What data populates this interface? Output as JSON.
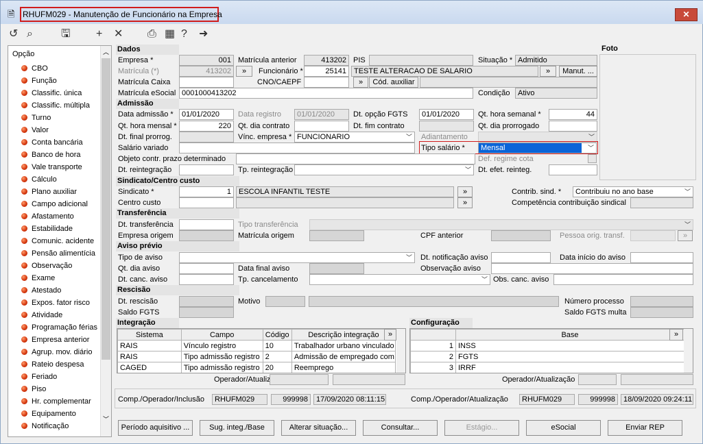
{
  "window": {
    "title": "RHUFM029 - Manutenção de Funcionário na Empresa"
  },
  "left_panel": {
    "header": "Opção",
    "items": [
      "CBO",
      "Função",
      "Classific. única",
      "Classific. múltipla",
      "Turno",
      "Valor",
      "Conta bancária",
      "Banco de hora",
      "Vale transporte",
      "Cálculo",
      "Plano auxiliar",
      "Campo adicional",
      "Afastamento",
      "Estabilidade",
      "Comunic. acidente",
      "Pensão alimentícia",
      "Observação",
      "Exame",
      "Atestado",
      "Expos. fator risco",
      "Atividade",
      "Programação férias",
      "Empresa anterior",
      "Agrup. mov. diário",
      "Rateio despesa",
      "Feriado",
      "Piso",
      "Hr. complementar",
      "Equipamento",
      "Notificação"
    ]
  },
  "foto": {
    "label": "Foto"
  },
  "dados": {
    "title": "Dados",
    "empresa_label": "Empresa *",
    "empresa": "001",
    "matricula_ant_label": "Matrícula anterior",
    "matricula_ant": "413202",
    "pis_label": "PIS",
    "situacao_label": "Situação *",
    "situacao": "Admitido",
    "matricula_label": "Matrícula (*)",
    "matricula": "413202",
    "funcionario_label": "Funcionário *",
    "funcionario": "25141",
    "funcionario_nome": "TESTE ALTERACAO DE SALARIO",
    "manut_btn": "Manut. ...",
    "matricula_caixa_label": "Matrícula Caixa",
    "cno_label": "CNO/CAEPF",
    "cod_aux_btn": "Cód. auxiliar",
    "matricula_esocial_label": "Matrícula eSocial",
    "matricula_esocial": "0001000413202",
    "condicao_label": "Condição",
    "condicao": "Ativo"
  },
  "admissao": {
    "title": "Admissão",
    "data_adm_label": "Data admissão *",
    "data_adm": "01/01/2020",
    "data_reg_label": "Data registro",
    "data_reg": "01/01/2020",
    "dt_opcao_label": "Dt. opção FGTS",
    "dt_opcao": "01/01/2020",
    "qt_hora_sem_label": "Qt. hora semanal *",
    "qt_hora_sem": "44",
    "qt_hora_mensal_label": "Qt. hora mensal *",
    "qt_hora_mensal": "220",
    "qt_dia_contrato_label": "Qt. dia contrato",
    "dt_fim_contrato_label": "Dt. fim contrato",
    "qt_dia_prorrogado_label": "Qt. dia prorrogado",
    "dt_final_prorrog_label": "Dt. final prorrog.",
    "vinc_empresa_label": "Vínc. empresa *",
    "vinc_empresa": "FUNCIONARIO",
    "adiantamento_label": "Adiantamento",
    "salario_variado_label": "Salário variado",
    "tipo_salario_label": "Tipo salário *",
    "tipo_salario": "Mensal",
    "objeto_label": "Objeto contr. prazo determinado",
    "def_regime_label": "Def. regime cota",
    "dt_reintegracao_label": "Dt. reintegração",
    "tp_reintegracao_label": "Tp. reintegração",
    "dt_efet_reinteg_label": "Dt. efet. reinteg."
  },
  "sindicato": {
    "title": "Sindicato/Centro custo",
    "sindicato_label": "Sindicato *",
    "sindicato": "1",
    "sindicato_nome": "ESCOLA INFANTIL TESTE",
    "centro_custo_label": "Centro custo",
    "contrib_label": "Contrib. sind. *",
    "contrib": "Contribuiu no ano base",
    "competencia_label": "Competência contribuição sindical"
  },
  "transferencia": {
    "title": "Transferência",
    "dt_transf_label": "Dt. transferência",
    "tipo_transf_label": "Tipo transferência",
    "empresa_origem_label": "Empresa origem",
    "matricula_origem_label": "Matrícula origem",
    "cpf_anterior_label": "CPF anterior",
    "pessoa_orig_label": "Pessoa orig. transf."
  },
  "aviso": {
    "title": "Aviso prévio",
    "tipo_label": "Tipo de aviso",
    "dt_notif_label": "Dt. notificação aviso",
    "data_inicio_label": "Data início do aviso",
    "qt_dia_label": "Qt. dia aviso",
    "data_final_label": "Data final aviso",
    "obs_label": "Observação aviso",
    "dt_canc_label": "Dt. canc. aviso",
    "tp_canc_label": "Tp. cancelamento",
    "obs_canc_label": "Obs. canc. aviso"
  },
  "rescisao": {
    "title": "Rescisão",
    "dt_label": "Dt. rescisão",
    "motivo_label": "Motivo",
    "num_proc_label": "Número processo",
    "saldo_fgts_label": "Saldo FGTS",
    "saldo_multa_label": "Saldo FGTS multa"
  },
  "integracao": {
    "title": "Integração",
    "headers": [
      "Sistema",
      "Campo",
      "Código",
      "Descrição integração"
    ],
    "rows": [
      [
        "RAIS",
        "Vínculo registro",
        "10",
        "Trabalhador urbano vinculado a"
      ],
      [
        "RAIS",
        "Tipo admissão registro",
        "2",
        "Admissão de empregado com e"
      ],
      [
        "CAGED",
        "Tipo admissão registro",
        "20",
        "Reemprego"
      ]
    ],
    "operador_label": "Operador/Atualização"
  },
  "configuracao": {
    "title": "Configuração",
    "header": "Base",
    "rows": [
      [
        "1",
        "INSS"
      ],
      [
        "2",
        "FGTS"
      ],
      [
        "3",
        "IRRF"
      ]
    ],
    "operador_label": "Operador/Atualização"
  },
  "footer": {
    "comp_inc_label": "Comp./Operador/Inclusão",
    "comp_inc_prog": "RHUFM029",
    "comp_inc_op": "999998",
    "comp_inc_dt": "17/09/2020 08:11:15",
    "comp_atu_label": "Comp./Operador/Atualização",
    "comp_atu_prog": "RHUFM029",
    "comp_atu_op": "999998",
    "comp_atu_dt": "18/09/2020 09:24:11"
  },
  "buttons": [
    "Período aquisitivo ...",
    "Sug. integ./Base",
    "Alterar situação...",
    "Consultar...",
    "Estágio...",
    "eSocial",
    "Enviar REP"
  ],
  "colors": {
    "highlight": "#d01c1c",
    "selection": "#0a64d8"
  }
}
